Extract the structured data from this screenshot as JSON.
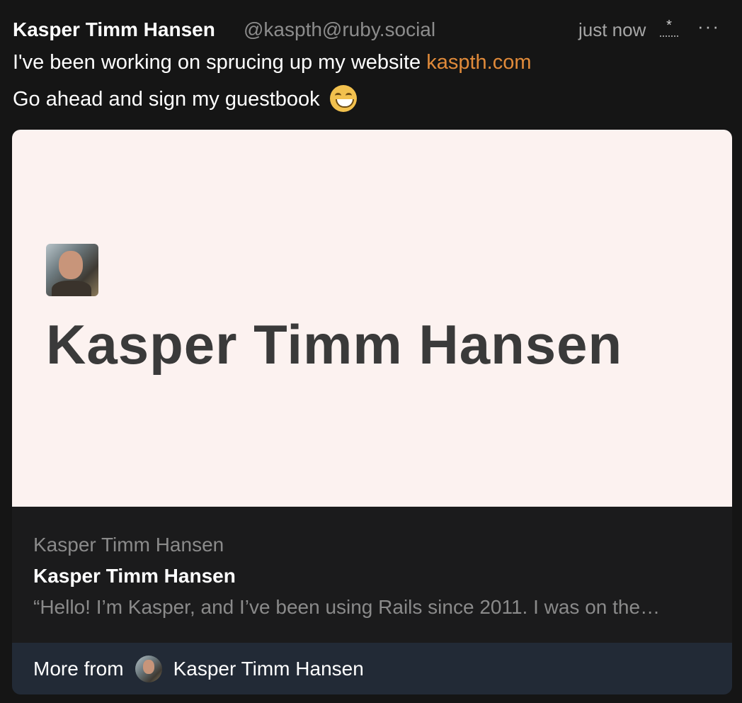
{
  "post": {
    "author": "Kasper Timm Hansen",
    "handle": "@kaspth@ruby.social",
    "time": "just now",
    "edited_marker": "*",
    "more_icon": "more-horizontal-icon",
    "text_line1": "I've been working on sprucing up my website ",
    "link": "kaspth.com",
    "text_line2": "Go ahead and sign my guestbook "
  },
  "card": {
    "preview_title": "Kasper Timm Hansen",
    "site": "Kasper Timm Hansen",
    "title": "Kasper Timm Hansen",
    "description": "“Hello! I’m Kasper, and I’ve been using Rails since 2011. I was on the…",
    "footer_label": "More from",
    "footer_name": "Kasper Timm Hansen"
  },
  "colors": {
    "background": "#151515",
    "link": "#e08a3a",
    "preview_background": "#fcf2f0",
    "footer_background": "#222a36"
  }
}
